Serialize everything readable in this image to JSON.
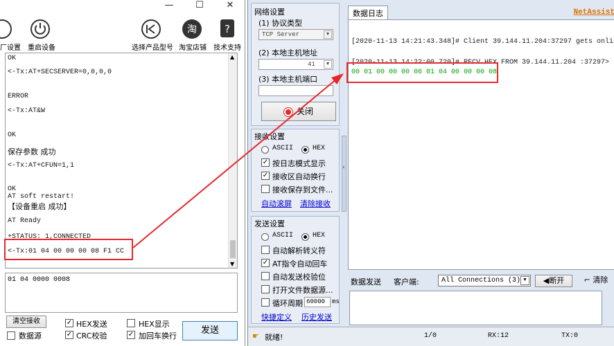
{
  "left_window": {
    "controls": {
      "minimize": "—",
      "maximize": "☐",
      "close": "✕"
    },
    "toolbar": {
      "factory_reset": "厂设置",
      "restart": "重启设备",
      "select_model": "选择产品型号",
      "taobao": "淘宝店铺",
      "tech_support": "技术支持"
    },
    "log_lines": [
      "OK",
      "<-Tx:AT+SECSERVER=0,0,0,0",
      "ERROR",
      "<-Tx:AT&W",
      "OK",
      "保存参数 成功",
      "<-Tx:AT+CFUN=1,1",
      "OK",
      "AT soft restart!",
      "【设备重启 成功】",
      "AT Ready",
      "+STATUS: 1,CONNECTED",
      "<-Tx:01 04 00 00 00 08 F1 CC"
    ],
    "send_input": "01 04 0000 0008",
    "bottom": {
      "clear_receive": "清空接收",
      "data_source": "数据源",
      "hex_send": "HEX发送",
      "crc_check": "CRC校验",
      "hex_display": "HEX显示",
      "add_newline": "加回车换行",
      "send": "发送"
    }
  },
  "right_window": {
    "network": {
      "title": "网络设置",
      "protocol_label": "(1) 协议类型",
      "protocol_value": "TCP Server",
      "host_label": "(2) 本地主机地址",
      "host_value": "41",
      "port_label": "(3) 本地主机端口",
      "close_button": "关闭"
    },
    "receive": {
      "title": "接收设置",
      "ascii": "ASCII",
      "hex": "HEX",
      "log_mode": "按日志模式显示",
      "auto_newline": "接收区自动换行",
      "save_file": "接收保存到文件...",
      "auto_scroll": "自动滚屏",
      "clear_receive": "清除接收"
    },
    "send_settings": {
      "title": "发送设置",
      "ascii": "ASCII",
      "hex": "HEX",
      "auto_escape": "自动解析转义符",
      "at_auto_cr": "AT指令自动回车",
      "auto_checksum": "自动发送校验位",
      "open_file": "打开文件数据源...",
      "loop_label": "循环周期",
      "loop_value": "60000",
      "loop_unit": "ms",
      "shortcut": "快捷定义",
      "history": "历史发送"
    },
    "log_tab": "数据日志",
    "brand": "NetAssist",
    "log": {
      "line1": "[2020-11-13 14:21:43.348]# Client 39.144.11.204:37297 gets online.",
      "line2": "[2020-11-13 14:22:00.720]# RECV HEX FROM 39.144.11.204 :37297>",
      "line3": "00 01 00 00 00 06 01 04 00 00 00 08"
    },
    "send_bar": {
      "tab": "数据发送",
      "client_label": "客户端:",
      "client_value": "All Connections (3)",
      "disconnect": "断开",
      "clear": "清除"
    },
    "status": {
      "ready": "就绪!",
      "page": "1/0",
      "rx": "RX:12",
      "tx": "TX:0"
    }
  },
  "colors": {
    "highlight": "#e8262a",
    "hex_green": "#00a000",
    "link": "#0000cc"
  }
}
